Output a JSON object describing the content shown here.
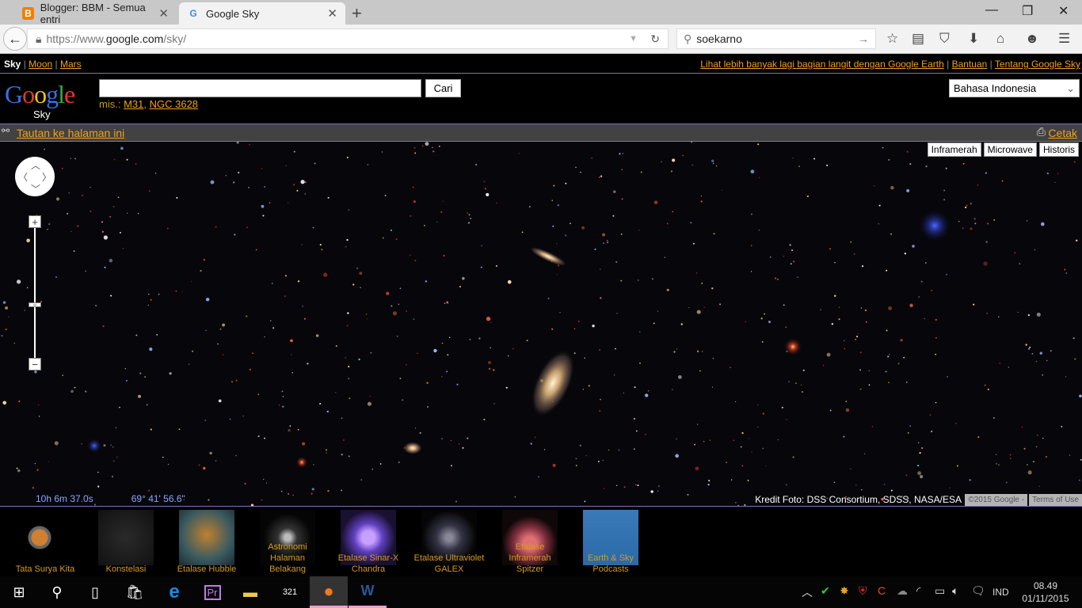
{
  "browser": {
    "tabs": [
      {
        "label": "Blogger: BBM - Semua entri",
        "icon": "blogger-icon",
        "active": false
      },
      {
        "label": "Google Sky",
        "icon": "google-g-icon",
        "active": true
      }
    ],
    "url_prefix": "https://www.",
    "url_domain": "google.com",
    "url_path": "/sky/",
    "search_value": "soekarno"
  },
  "toplinks": {
    "current": "Sky",
    "left": [
      "Moon",
      "Mars"
    ],
    "right": [
      "Lihat lebih banyak lagi bagian langit dengan Google Earth",
      "Bantuan",
      "Tentang Google Sky"
    ]
  },
  "header": {
    "logo": "Google",
    "logo_sub": "Sky",
    "search_value": "",
    "search_button": "Cari",
    "examples_label": "mis.:",
    "examples": [
      "M31",
      "NGC 3628"
    ],
    "language": "Bahasa Indonesia"
  },
  "bar": {
    "link_label": "Tautan ke halaman ini",
    "print_label": "Cetak"
  },
  "map": {
    "layers": [
      "Inframerah",
      "Microwave",
      "Historis"
    ],
    "ra": "10h 6m 37.0s",
    "dec": "69° 41' 56.6\"",
    "credit": "Kredit Foto: DSS Consortium, SDSS, NASA/ESA",
    "copyright": "©2015 Google -",
    "terms": "Terms of Use"
  },
  "gallery": [
    {
      "label": "Tata Surya Kita"
    },
    {
      "label": "Konstelasi"
    },
    {
      "label": "Etalase Hubble"
    },
    {
      "label": "Astronomi Halaman Belakang"
    },
    {
      "label": "Etalase Sinar-X Chandra"
    },
    {
      "label": "Etalase Ultraviolet GALEX"
    },
    {
      "label": "Etalase Inframerah Spitzer"
    },
    {
      "label": "Earth & Sky Podcasts"
    }
  ],
  "taskbar": {
    "language": "IND",
    "time": "08.49",
    "date": "01/11/2015"
  },
  "colors": {
    "link": "#f0a01c",
    "divider": "#7b74b8",
    "bar": "#424242"
  }
}
